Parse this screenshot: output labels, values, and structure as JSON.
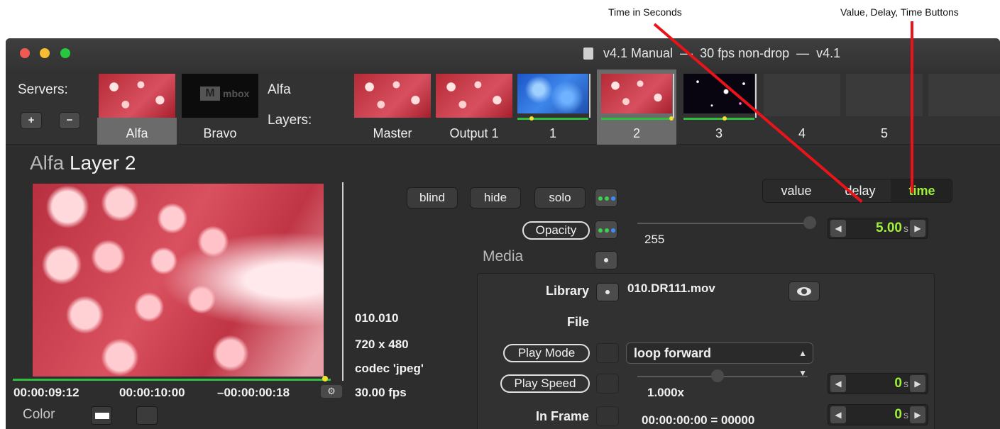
{
  "annotations": {
    "time_in_seconds": "Time in Seconds",
    "value_delay_time": "Value, Delay, Time Buttons"
  },
  "window": {
    "title": "v4.1 Manual  —  30 fps non-drop  —  v4.1"
  },
  "servers": {
    "label": "Servers:",
    "add_symbol": "+",
    "remove_symbol": "−",
    "items": [
      {
        "label": "Alfa",
        "selected": true
      },
      {
        "label": "Bravo",
        "selected": false
      }
    ],
    "bravo_logo_letter": "M",
    "bravo_logo_text": "mbox"
  },
  "layers": {
    "server_name": "Alfa",
    "label": "Layers:",
    "items": [
      {
        "label": "Master"
      },
      {
        "label": "Output 1"
      },
      {
        "label": "1"
      },
      {
        "label": "2",
        "selected": true
      },
      {
        "label": "3"
      },
      {
        "label": "4"
      },
      {
        "label": "5"
      }
    ]
  },
  "panel": {
    "heading_server": "Alfa",
    "heading_layer": "Layer 2",
    "timecodes": {
      "current": "00:00:09:12",
      "duration": "00:00:10:00",
      "remaining": "–00:00:00:18"
    },
    "gear_icon": "gear-icon",
    "color_label": "Color",
    "file_info": {
      "id": "010.010",
      "resolution": "720 x 480",
      "codec": "codec 'jpeg'",
      "fps": "30.00 fps"
    }
  },
  "buttons": {
    "blind": "blind",
    "hide": "hide",
    "solo": "solo"
  },
  "mode_tabs": {
    "value": "value",
    "delay": "delay",
    "time": "time",
    "active": "time"
  },
  "opacity": {
    "label": "Opacity",
    "value": "255",
    "time": "5.00",
    "unit": "s"
  },
  "media": {
    "label": "Media",
    "library_label": "Library",
    "library_value": "010.DR111.mov",
    "file_label": "File",
    "play_mode_label": "Play Mode",
    "play_mode_value": "loop forward",
    "play_speed_label": "Play Speed",
    "play_speed_value": "1.000x",
    "play_speed_time": "0",
    "play_speed_unit": "s",
    "in_frame_label": "In Frame",
    "in_frame_value": "00:00:00:00 = 00000",
    "in_frame_time": "0",
    "in_frame_unit": "s"
  },
  "colors": {
    "accent_green": "#9ff03a",
    "annotation_red": "#e8141a",
    "bar_green": "#2fbf3f"
  }
}
